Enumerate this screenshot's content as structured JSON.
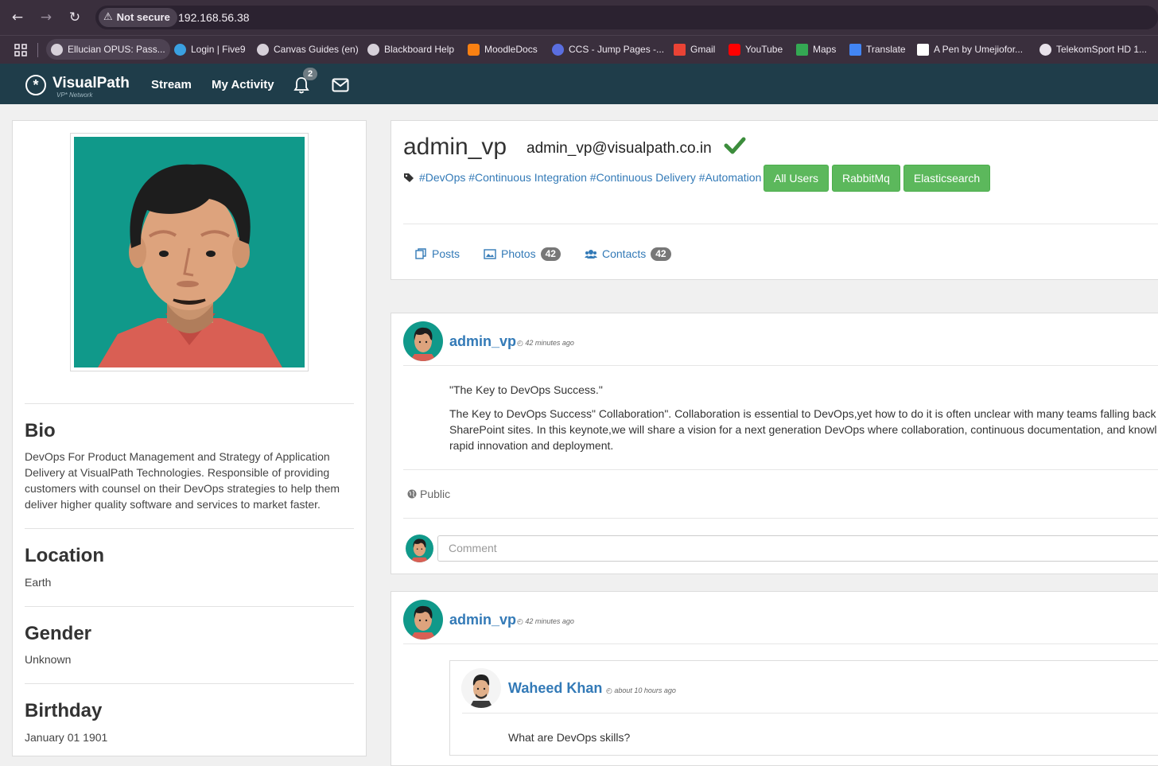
{
  "browser": {
    "security_label": "Not secure",
    "url": "192.168.56.38",
    "bookmarks": [
      {
        "label": "Ellucian OPUS: Pass...",
        "icon": "globe-icon"
      },
      {
        "label": "Login | Five9",
        "icon": "five9-icon"
      },
      {
        "label": "Canvas Guides (en)",
        "icon": "globe-icon"
      },
      {
        "label": "Blackboard Help",
        "icon": "globe-icon"
      },
      {
        "label": "MoodleDocs",
        "icon": "moodle-icon"
      },
      {
        "label": "CCS - Jump Pages -...",
        "icon": "ccs-icon"
      },
      {
        "label": "Gmail",
        "icon": "gmail-icon"
      },
      {
        "label": "YouTube",
        "icon": "youtube-icon"
      },
      {
        "label": "Maps",
        "icon": "maps-icon"
      },
      {
        "label": "Translate",
        "icon": "translate-icon"
      },
      {
        "label": "A Pen by Umejiofor...",
        "icon": "codepen-icon"
      },
      {
        "label": "TelekomSport HD 1...",
        "icon": "gear-icon"
      }
    ]
  },
  "site": {
    "brand": "VisualPath",
    "brand_sub": "VP* Network",
    "nav": {
      "stream": "Stream",
      "activity": "My Activity"
    },
    "notification_count": "2"
  },
  "profile": {
    "username": "admin_vp",
    "email": "admin_vp@visualpath.co.in",
    "tags": "#DevOps #Continuous Integration #Continuous Delivery #Automation",
    "groups": [
      "All Users",
      "RabbitMq",
      "Elasticsearch"
    ],
    "tabs": {
      "posts": "Posts",
      "photos": "Photos",
      "photos_count": "42",
      "contacts": "Contacts",
      "contacts_count": "42"
    }
  },
  "sidebar": {
    "bio_title": "Bio",
    "bio_text": "DevOps For Product Management and Strategy of Application Delivery at VisualPath Technologies. Responsible of providing customers with counsel on their DevOps strategies to help them deliver higher quality software and services to market faster.",
    "location_title": "Location",
    "location": "Earth",
    "gender_title": "Gender",
    "gender": "Unknown",
    "birthday_title": "Birthday",
    "birthday": "January 01 1901"
  },
  "posts": [
    {
      "author": "admin_vp",
      "time": "42 minutes ago",
      "title": "\"The Key to DevOps Success.\"",
      "body_lines": [
        "The Key to DevOps Success\" Collaboration\". Collaboration is essential to DevOps,yet how to do it is often unclear with many teams falling back",
        "SharePoint sites. In this keynote,we will share a vision for a next generation DevOps where collaboration, continuous documentation, and knowl",
        "rapid innovation and deployment."
      ],
      "visibility": "Public",
      "comment_placeholder": "Comment"
    },
    {
      "author": "admin_vp",
      "time": "42 minutes ago",
      "shared_author": "Waheed Khan",
      "shared_time": "about 10 hours ago",
      "shared_text": "What are DevOps skills?"
    }
  ]
}
